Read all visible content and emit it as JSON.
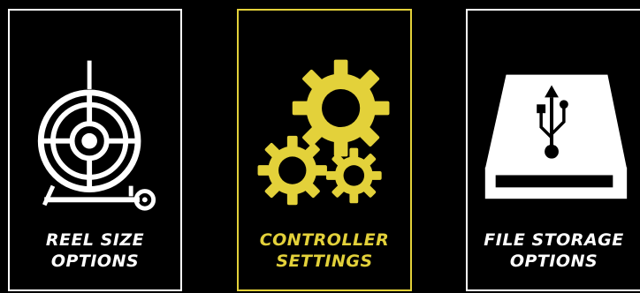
{
  "tiles": [
    {
      "line1": "REEL SIZE",
      "line2": "OPTIONS",
      "icon": "cable-reel-icon"
    },
    {
      "line1": "CONTROLLER",
      "line2": "SETTINGS",
      "icon": "gears-icon",
      "selected": true
    },
    {
      "line1": "FILE STORAGE",
      "line2": "OPTIONS",
      "icon": "usb-drive-icon"
    }
  ],
  "colors": {
    "background": "#000000",
    "default": "#ffffff",
    "selected": "#e3d13a"
  }
}
